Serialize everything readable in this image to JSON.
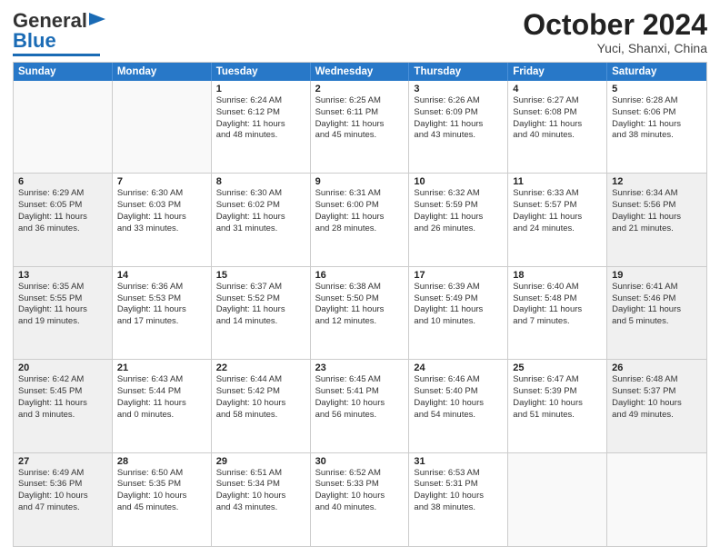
{
  "header": {
    "logo_line1": "General",
    "logo_line2": "Blue",
    "month_title": "October 2024",
    "location": "Yuci, Shanxi, China"
  },
  "days_of_week": [
    "Sunday",
    "Monday",
    "Tuesday",
    "Wednesday",
    "Thursday",
    "Friday",
    "Saturday"
  ],
  "rows": [
    [
      {
        "num": "",
        "empty": true
      },
      {
        "num": "",
        "empty": true
      },
      {
        "num": "1",
        "lines": [
          "Sunrise: 6:24 AM",
          "Sunset: 6:12 PM",
          "Daylight: 11 hours",
          "and 48 minutes."
        ]
      },
      {
        "num": "2",
        "lines": [
          "Sunrise: 6:25 AM",
          "Sunset: 6:11 PM",
          "Daylight: 11 hours",
          "and 45 minutes."
        ]
      },
      {
        "num": "3",
        "lines": [
          "Sunrise: 6:26 AM",
          "Sunset: 6:09 PM",
          "Daylight: 11 hours",
          "and 43 minutes."
        ]
      },
      {
        "num": "4",
        "lines": [
          "Sunrise: 6:27 AM",
          "Sunset: 6:08 PM",
          "Daylight: 11 hours",
          "and 40 minutes."
        ]
      },
      {
        "num": "5",
        "lines": [
          "Sunrise: 6:28 AM",
          "Sunset: 6:06 PM",
          "Daylight: 11 hours",
          "and 38 minutes."
        ]
      }
    ],
    [
      {
        "num": "6",
        "shaded": true,
        "lines": [
          "Sunrise: 6:29 AM",
          "Sunset: 6:05 PM",
          "Daylight: 11 hours",
          "and 36 minutes."
        ]
      },
      {
        "num": "7",
        "lines": [
          "Sunrise: 6:30 AM",
          "Sunset: 6:03 PM",
          "Daylight: 11 hours",
          "and 33 minutes."
        ]
      },
      {
        "num": "8",
        "lines": [
          "Sunrise: 6:30 AM",
          "Sunset: 6:02 PM",
          "Daylight: 11 hours",
          "and 31 minutes."
        ]
      },
      {
        "num": "9",
        "lines": [
          "Sunrise: 6:31 AM",
          "Sunset: 6:00 PM",
          "Daylight: 11 hours",
          "and 28 minutes."
        ]
      },
      {
        "num": "10",
        "lines": [
          "Sunrise: 6:32 AM",
          "Sunset: 5:59 PM",
          "Daylight: 11 hours",
          "and 26 minutes."
        ]
      },
      {
        "num": "11",
        "lines": [
          "Sunrise: 6:33 AM",
          "Sunset: 5:57 PM",
          "Daylight: 11 hours",
          "and 24 minutes."
        ]
      },
      {
        "num": "12",
        "shaded": true,
        "lines": [
          "Sunrise: 6:34 AM",
          "Sunset: 5:56 PM",
          "Daylight: 11 hours",
          "and 21 minutes."
        ]
      }
    ],
    [
      {
        "num": "13",
        "shaded": true,
        "lines": [
          "Sunrise: 6:35 AM",
          "Sunset: 5:55 PM",
          "Daylight: 11 hours",
          "and 19 minutes."
        ]
      },
      {
        "num": "14",
        "lines": [
          "Sunrise: 6:36 AM",
          "Sunset: 5:53 PM",
          "Daylight: 11 hours",
          "and 17 minutes."
        ]
      },
      {
        "num": "15",
        "lines": [
          "Sunrise: 6:37 AM",
          "Sunset: 5:52 PM",
          "Daylight: 11 hours",
          "and 14 minutes."
        ]
      },
      {
        "num": "16",
        "lines": [
          "Sunrise: 6:38 AM",
          "Sunset: 5:50 PM",
          "Daylight: 11 hours",
          "and 12 minutes."
        ]
      },
      {
        "num": "17",
        "lines": [
          "Sunrise: 6:39 AM",
          "Sunset: 5:49 PM",
          "Daylight: 11 hours",
          "and 10 minutes."
        ]
      },
      {
        "num": "18",
        "lines": [
          "Sunrise: 6:40 AM",
          "Sunset: 5:48 PM",
          "Daylight: 11 hours",
          "and 7 minutes."
        ]
      },
      {
        "num": "19",
        "shaded": true,
        "lines": [
          "Sunrise: 6:41 AM",
          "Sunset: 5:46 PM",
          "Daylight: 11 hours",
          "and 5 minutes."
        ]
      }
    ],
    [
      {
        "num": "20",
        "shaded": true,
        "lines": [
          "Sunrise: 6:42 AM",
          "Sunset: 5:45 PM",
          "Daylight: 11 hours",
          "and 3 minutes."
        ]
      },
      {
        "num": "21",
        "lines": [
          "Sunrise: 6:43 AM",
          "Sunset: 5:44 PM",
          "Daylight: 11 hours",
          "and 0 minutes."
        ]
      },
      {
        "num": "22",
        "lines": [
          "Sunrise: 6:44 AM",
          "Sunset: 5:42 PM",
          "Daylight: 10 hours",
          "and 58 minutes."
        ]
      },
      {
        "num": "23",
        "lines": [
          "Sunrise: 6:45 AM",
          "Sunset: 5:41 PM",
          "Daylight: 10 hours",
          "and 56 minutes."
        ]
      },
      {
        "num": "24",
        "lines": [
          "Sunrise: 6:46 AM",
          "Sunset: 5:40 PM",
          "Daylight: 10 hours",
          "and 54 minutes."
        ]
      },
      {
        "num": "25",
        "lines": [
          "Sunrise: 6:47 AM",
          "Sunset: 5:39 PM",
          "Daylight: 10 hours",
          "and 51 minutes."
        ]
      },
      {
        "num": "26",
        "shaded": true,
        "lines": [
          "Sunrise: 6:48 AM",
          "Sunset: 5:37 PM",
          "Daylight: 10 hours",
          "and 49 minutes."
        ]
      }
    ],
    [
      {
        "num": "27",
        "shaded": true,
        "lines": [
          "Sunrise: 6:49 AM",
          "Sunset: 5:36 PM",
          "Daylight: 10 hours",
          "and 47 minutes."
        ]
      },
      {
        "num": "28",
        "lines": [
          "Sunrise: 6:50 AM",
          "Sunset: 5:35 PM",
          "Daylight: 10 hours",
          "and 45 minutes."
        ]
      },
      {
        "num": "29",
        "lines": [
          "Sunrise: 6:51 AM",
          "Sunset: 5:34 PM",
          "Daylight: 10 hours",
          "and 43 minutes."
        ]
      },
      {
        "num": "30",
        "lines": [
          "Sunrise: 6:52 AM",
          "Sunset: 5:33 PM",
          "Daylight: 10 hours",
          "and 40 minutes."
        ]
      },
      {
        "num": "31",
        "lines": [
          "Sunrise: 6:53 AM",
          "Sunset: 5:31 PM",
          "Daylight: 10 hours",
          "and 38 minutes."
        ]
      },
      {
        "num": "",
        "empty": true
      },
      {
        "num": "",
        "empty": true
      }
    ]
  ]
}
